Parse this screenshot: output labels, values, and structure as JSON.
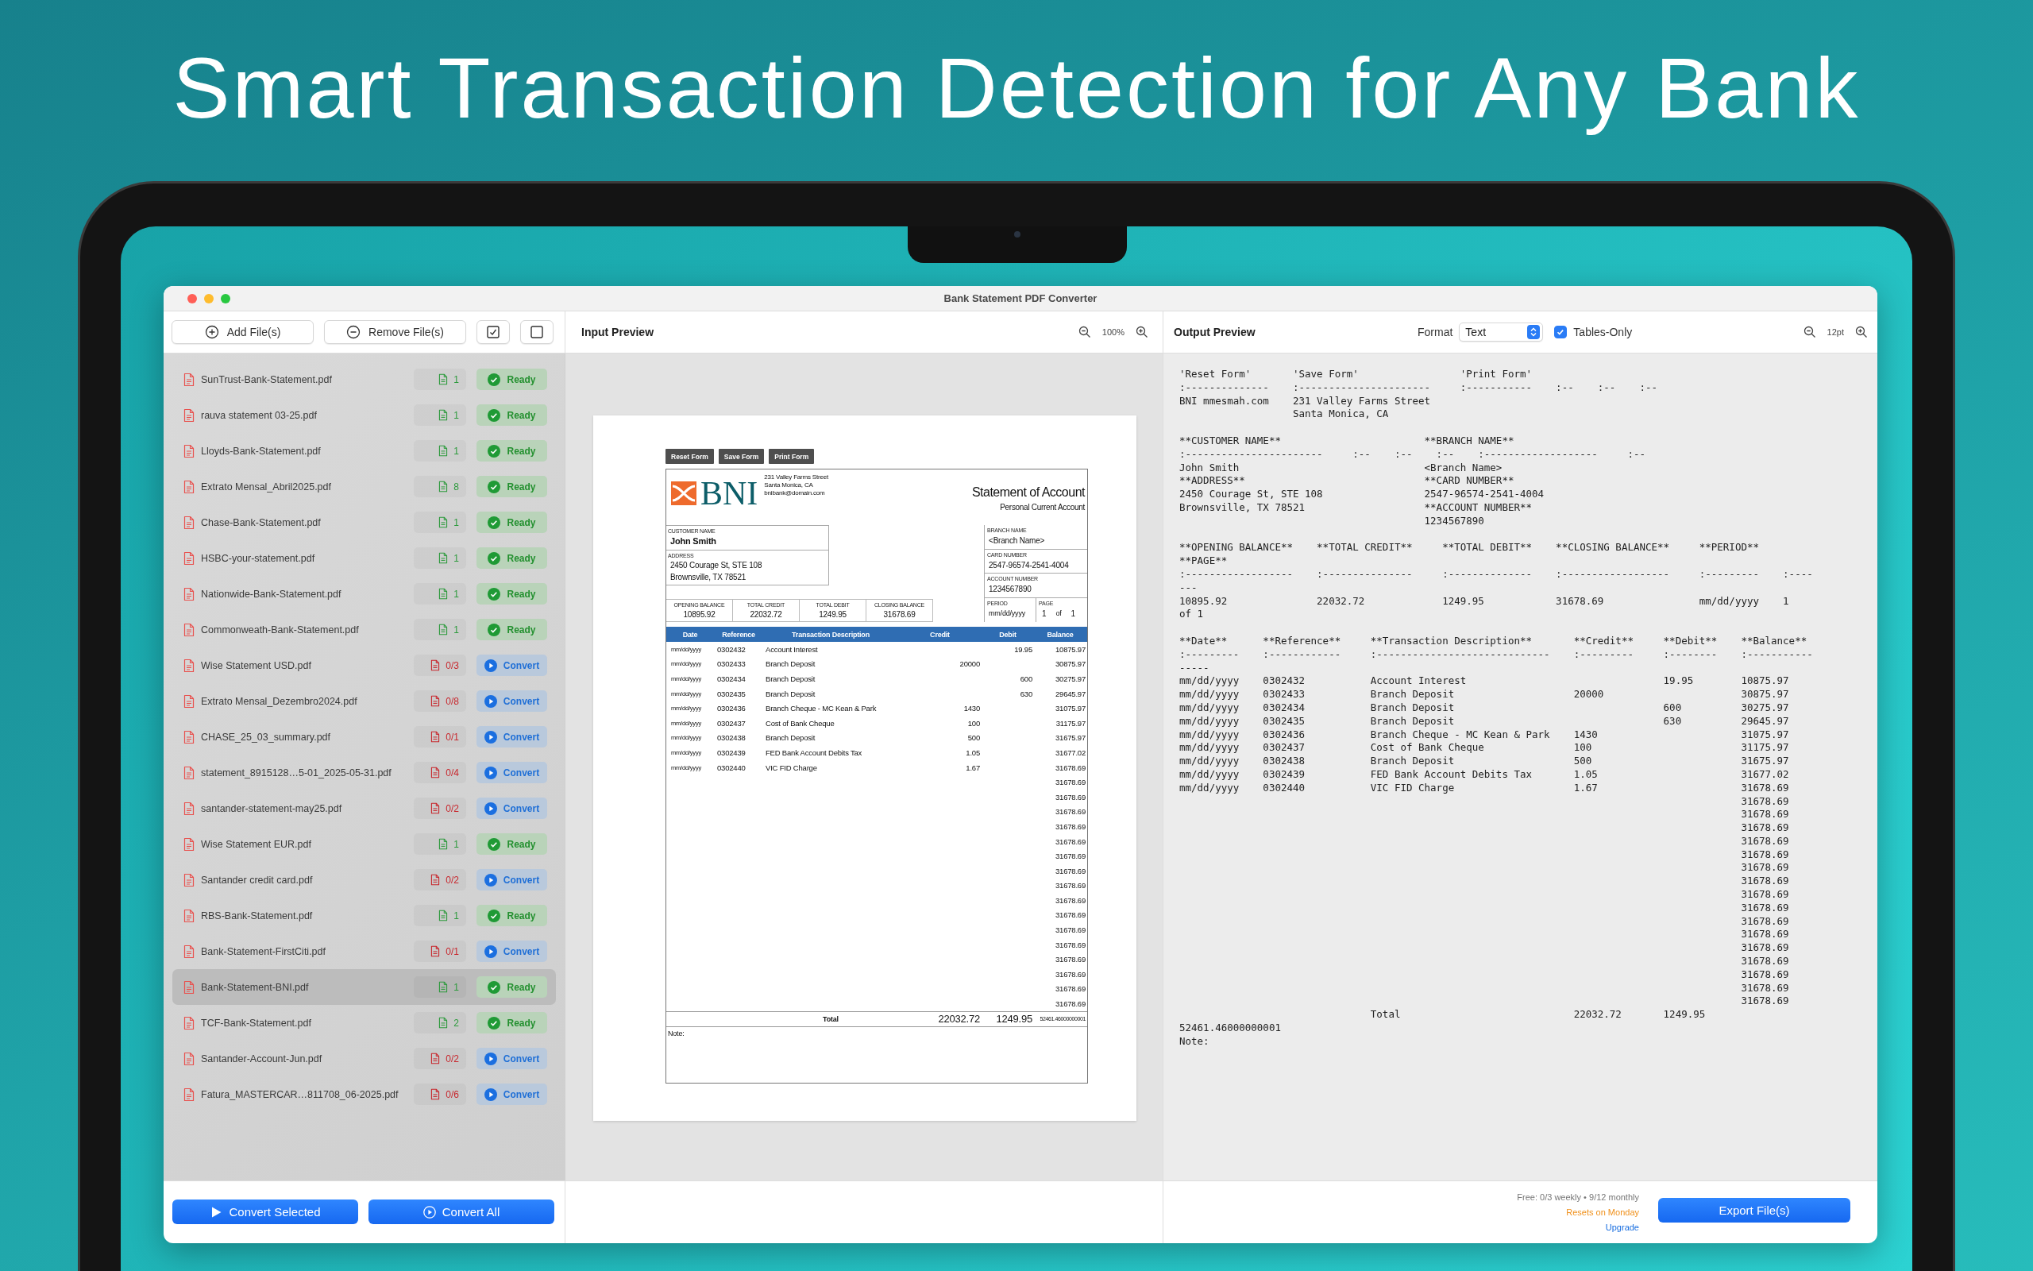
{
  "headline": "Smart Transaction Detection for Any Bank",
  "window": {
    "title": "Bank Statement PDF Converter"
  },
  "toolbar": {
    "add_button": "Add File(s)",
    "remove_button": "Remove File(s)"
  },
  "files": [
    {
      "name": "SunTrust-Bank-Statement.pdf",
      "pages": "1",
      "kind": "ready",
      "status": "Ready",
      "selected": false
    },
    {
      "name": "rauva statement 03-25.pdf",
      "pages": "1",
      "kind": "ready",
      "status": "Ready",
      "selected": false
    },
    {
      "name": "Lloyds-Bank-Statement.pdf",
      "pages": "1",
      "kind": "ready",
      "status": "Ready",
      "selected": false
    },
    {
      "name": "Extrato Mensal_Abril2025.pdf",
      "pages": "8",
      "kind": "ready",
      "status": "Ready",
      "selected": false
    },
    {
      "name": "Chase-Bank-Statement.pdf",
      "pages": "1",
      "kind": "ready",
      "status": "Ready",
      "selected": false
    },
    {
      "name": "HSBC-your-statement.pdf",
      "pages": "1",
      "kind": "ready",
      "status": "Ready",
      "selected": false
    },
    {
      "name": "Nationwide-Bank-Statement.pdf",
      "pages": "1",
      "kind": "ready",
      "status": "Ready",
      "selected": false
    },
    {
      "name": "Commonweath-Bank-Statement.pdf",
      "pages": "1",
      "kind": "ready",
      "status": "Ready",
      "selected": false
    },
    {
      "name": "Wise Statement USD.pdf",
      "pages": "0/3",
      "kind": "convert",
      "status": "Convert",
      "selected": false
    },
    {
      "name": "Extrato Mensal_Dezembro2024.pdf",
      "pages": "0/8",
      "kind": "convert",
      "status": "Convert",
      "selected": false
    },
    {
      "name": "CHASE_25_03_summary.pdf",
      "pages": "0/1",
      "kind": "convert",
      "status": "Convert",
      "selected": false
    },
    {
      "name": "statement_8915128…5-01_2025-05-31.pdf",
      "pages": "0/4",
      "kind": "convert",
      "status": "Convert",
      "selected": false
    },
    {
      "name": "santander-statement-may25.pdf",
      "pages": "0/2",
      "kind": "convert",
      "status": "Convert",
      "selected": false
    },
    {
      "name": "Wise Statement EUR.pdf",
      "pages": "1",
      "kind": "ready",
      "status": "Ready",
      "selected": false
    },
    {
      "name": "Santander credit card.pdf",
      "pages": "0/2",
      "kind": "convert",
      "status": "Convert",
      "selected": false
    },
    {
      "name": "RBS-Bank-Statement.pdf",
      "pages": "1",
      "kind": "ready",
      "status": "Ready",
      "selected": false
    },
    {
      "name": "Bank-Statement-FirstCiti.pdf",
      "pages": "0/1",
      "kind": "convert",
      "status": "Convert",
      "selected": false
    },
    {
      "name": "Bank-Statement-BNI.pdf",
      "pages": "1",
      "kind": "ready",
      "status": "Ready",
      "selected": true
    },
    {
      "name": "TCF-Bank-Statement.pdf",
      "pages": "2",
      "kind": "ready",
      "status": "Ready",
      "selected": false
    },
    {
      "name": "Santander-Account-Jun.pdf",
      "pages": "0/2",
      "kind": "convert",
      "status": "Convert",
      "selected": false
    },
    {
      "name": "Fatura_MASTERCAR…811708_06-2025.pdf",
      "pages": "0/6",
      "kind": "convert",
      "status": "Convert",
      "selected": false
    }
  ],
  "sidebar_buttons": {
    "convert_selected": "Convert Selected",
    "convert_all": "Convert All"
  },
  "input_preview": {
    "title": "Input Preview",
    "zoom": "100%",
    "document": {
      "buttons": [
        "Reset Form",
        "Save Form",
        "Print Form"
      ],
      "bank_name": "BNI",
      "bank_address": [
        "231 Valley Farms Street",
        "Santa Monica, CA",
        "bnibank@domain.com"
      ],
      "title": "Statement of Account",
      "subtitle": "Personal Current Account",
      "customer": {
        "name_label": "CUSTOMER NAME",
        "name": "John Smith",
        "address_label": "ADDRESS",
        "address": [
          "2450 Courage St, STE 108",
          "Brownsville, TX 78521"
        ]
      },
      "branch": [
        {
          "label": "BRANCH NAME",
          "value": "<Branch Name>"
        },
        {
          "label": "CARD NUMBER",
          "value": "2547-96574-2541-4004"
        },
        {
          "label": "ACCOUNT NUMBER",
          "value": "1234567890"
        }
      ],
      "period": {
        "label": "PERIOD",
        "value": "mm/dd/yyyy"
      },
      "page": {
        "label": "PAGE",
        "current": "1",
        "of": "of",
        "total": "1"
      },
      "summary": [
        {
          "label": "OPENING BALANCE",
          "value": "10895.92"
        },
        {
          "label": "TOTAL CREDIT",
          "value": "22032.72"
        },
        {
          "label": "TOTAL DEBIT",
          "value": "1249.95"
        },
        {
          "label": "CLOSING BALANCE",
          "value": "31678.69"
        }
      ],
      "columns": [
        "Date",
        "Reference",
        "Transaction Description",
        "Credit",
        "Debit",
        "Balance"
      ],
      "rows": [
        {
          "date": "mm/dd/yyyy",
          "reference": "0302432",
          "description": "Account Interest",
          "debit": "19.95",
          "balance": "10875.97"
        },
        {
          "date": "mm/dd/yyyy",
          "reference": "0302433",
          "description": "Branch Deposit",
          "credit": "20000",
          "balance": "30875.97"
        },
        {
          "date": "mm/dd/yyyy",
          "reference": "0302434",
          "description": "Branch Deposit",
          "debit": "600",
          "balance": "30275.97"
        },
        {
          "date": "mm/dd/yyyy",
          "reference": "0302435",
          "description": "Branch Deposit",
          "debit": "630",
          "balance": "29645.97"
        },
        {
          "date": "mm/dd/yyyy",
          "reference": "0302436",
          "description": "Branch Cheque - MC Kean & Park",
          "credit": "1430",
          "balance": "31075.97"
        },
        {
          "date": "mm/dd/yyyy",
          "reference": "0302437",
          "description": "Cost of Bank Cheque",
          "credit": "100",
          "balance": "31175.97"
        },
        {
          "date": "mm/dd/yyyy",
          "reference": "0302438",
          "description": "Branch Deposit",
          "credit": "500",
          "balance": "31675.97"
        },
        {
          "date": "mm/dd/yyyy",
          "reference": "0302439",
          "description": "FED Bank Account Debits Tax",
          "credit": "1.05",
          "balance": "31677.02"
        },
        {
          "date": "mm/dd/yyyy",
          "reference": "0302440",
          "description": "VIC FID Charge",
          "credit": "1.67",
          "balance": "31678.69"
        },
        {
          "balance": "31678.69"
        },
        {
          "balance": "31678.69"
        },
        {
          "balance": "31678.69"
        },
        {
          "balance": "31678.69"
        },
        {
          "balance": "31678.69"
        },
        {
          "balance": "31678.69"
        },
        {
          "balance": "31678.69"
        },
        {
          "balance": "31678.69"
        },
        {
          "balance": "31678.69"
        },
        {
          "balance": "31678.69"
        },
        {
          "balance": "31678.69"
        },
        {
          "balance": "31678.69"
        },
        {
          "balance": "31678.69"
        },
        {
          "balance": "31678.69"
        },
        {
          "balance": "31678.69"
        },
        {
          "balance": "31678.69"
        }
      ],
      "total": {
        "label": "Total",
        "credit": "22032.72",
        "debit": "1249.95",
        "balance": "52461.46000000001"
      },
      "note_label": "Note:"
    }
  },
  "output_preview": {
    "title": "Output Preview",
    "format_label": "Format",
    "format_value": "Text",
    "tables_only": {
      "label": "Tables-Only",
      "checked": true
    },
    "font_size": "12pt",
    "blocks": [
      [
        "'Reset Form'       'Save Form'                 'Print Form'",
        ":--------------    :----------------------     :-----------    :--    :--    :--",
        "BNI mmesmah.com    231 Valley Farms Street",
        "                   Santa Monica, CA"
      ],
      [
        "**CUSTOMER NAME**                        **BRANCH NAME**",
        ":-----------------------     :--    :--    :--    :-------------------     :--",
        "John Smith                               <Branch Name>",
        "**ADDRESS**                              **CARD NUMBER**",
        "2450 Courage St, STE 108                 2547-96574-2541-4004",
        "Brownsville, TX 78521                    **ACCOUNT NUMBER**",
        "                                         1234567890"
      ],
      [
        "**OPENING BALANCE**    **TOTAL CREDIT**     **TOTAL DEBIT**    **CLOSING BALANCE**     **PERIOD**",
        "**PAGE**",
        ":------------------    :---------------     :--------------    :------------------     :---------    :----",
        "---",
        "10895.92               22032.72             1249.95            31678.69                mm/dd/yyyy    1",
        "of 1"
      ],
      [
        "**Date**      **Reference**     **Transaction Description**       **Credit**     **Debit**    **Balance**",
        ":---------    :------------     :-----------------------------    :---------     :--------    :-----------",
        "-----",
        "mm/dd/yyyy    0302432           Account Interest                                 19.95        10875.97",
        "mm/dd/yyyy    0302433           Branch Deposit                    20000                       30875.97",
        "mm/dd/yyyy    0302434           Branch Deposit                                   600          30275.97",
        "mm/dd/yyyy    0302435           Branch Deposit                                   630          29645.97",
        "mm/dd/yyyy    0302436           Branch Cheque - MC Kean & Park    1430                        31075.97",
        "mm/dd/yyyy    0302437           Cost of Bank Cheque               100                         31175.97",
        "mm/dd/yyyy    0302438           Branch Deposit                    500                         31675.97",
        "mm/dd/yyyy    0302439           FED Bank Account Debits Tax       1.05                        31677.02",
        "mm/dd/yyyy    0302440           VIC FID Charge                    1.67                        31678.69",
        "                                                                                              31678.69",
        "                                                                                              31678.69",
        "                                                                                              31678.69",
        "                                                                                              31678.69",
        "                                                                                              31678.69",
        "                                                                                              31678.69",
        "                                                                                              31678.69",
        "                                                                                              31678.69",
        "                                                                                              31678.69",
        "                                                                                              31678.69",
        "                                                                                              31678.69",
        "                                                                                              31678.69",
        "                                                                                              31678.69",
        "                                                                                              31678.69",
        "                                                                                              31678.69",
        "                                                                                              31678.69",
        "                                Total                             22032.72       1249.95",
        "52461.46000000001",
        "Note:"
      ]
    ]
  },
  "footer": {
    "usage": "Free: 0/3 weekly • 9/12 monthly",
    "reset_note": "Resets on Monday",
    "upgrade_link": "Upgrade",
    "export_button": "Export File(s)"
  }
}
